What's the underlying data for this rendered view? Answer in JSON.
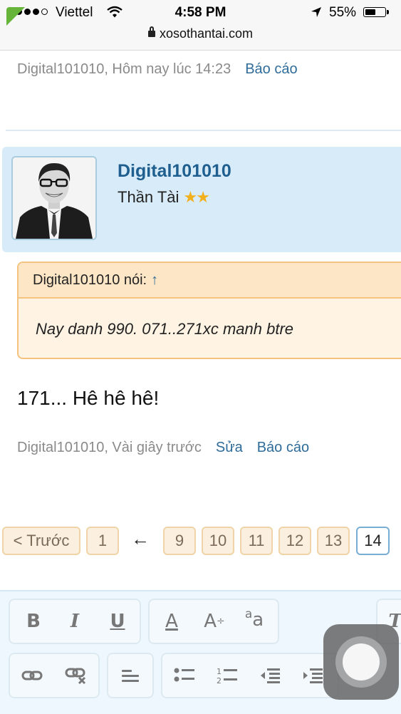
{
  "status_bar": {
    "carrier": "Viettel",
    "time": "4:58 PM",
    "battery_percent": "55%",
    "battery_level": 0.55
  },
  "browser": {
    "url": "xosothantai.com"
  },
  "previous_post": {
    "meta": "Digital101010, Hôm nay lúc 14:23",
    "report_label": "Báo cáo"
  },
  "post": {
    "username": "Digital101010",
    "rank": "Thần Tài",
    "stars": 2,
    "quote": {
      "author_label": "Digital101010 nói:",
      "arrow": "↑",
      "text": "Nay danh 990. 071..271xc manh btre"
    },
    "message": "171... Hê hê hê!",
    "meta": "Digital101010, Vài giây trước",
    "edit_label": "Sửa",
    "report_label": "Báo cáo"
  },
  "pagination": {
    "prev_label": "< Trước",
    "first": "1",
    "gap_arrow": "←",
    "pages": [
      "9",
      "10",
      "11",
      "12",
      "13",
      "14"
    ],
    "current": "14"
  },
  "editor_toolbar": {
    "bold": "B",
    "italic": "I",
    "underline": "U",
    "font_color": "A",
    "font_size": "A",
    "font_size_mark": "÷",
    "font_family_small": "a",
    "font_family_big": "a"
  }
}
